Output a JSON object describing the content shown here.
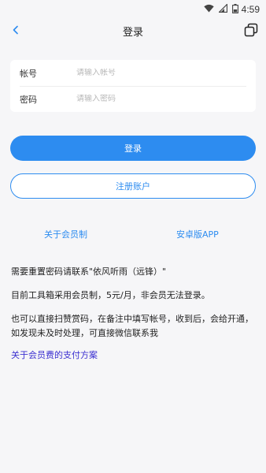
{
  "status_bar": {
    "time": "4:59",
    "icons": [
      "wifi-icon",
      "signal-icon",
      "battery-icon"
    ]
  },
  "header": {
    "title": "登录",
    "back_icon": "chevron-left-icon",
    "window_icon": "window-toggle-icon"
  },
  "form": {
    "account": {
      "label": "帐号",
      "placeholder": "请输入帐号",
      "value": ""
    },
    "password": {
      "label": "密码",
      "placeholder": "请输入密码",
      "value": ""
    }
  },
  "buttons": {
    "login": "登录",
    "register": "注册账户"
  },
  "links": {
    "about_membership": "关于会员制",
    "android_app": "安卓版APP",
    "fee_payment": "关于会员费的支付方案"
  },
  "notices": {
    "reset_password": "需要重置密码请联系\"依风听雨（远锋）\"",
    "membership_info": "目前工具箱采用会员制，5元/月，非会员无法登录。",
    "payment_info": "也可以直接扫赞赏码，在备注中填写帐号，收到后，会给开通，如发现未及时处理，可直接微信联系我"
  },
  "colors": {
    "accent": "#2d8cf0",
    "fee_link": "#3b2fd0",
    "background": "#f6f6f8"
  }
}
